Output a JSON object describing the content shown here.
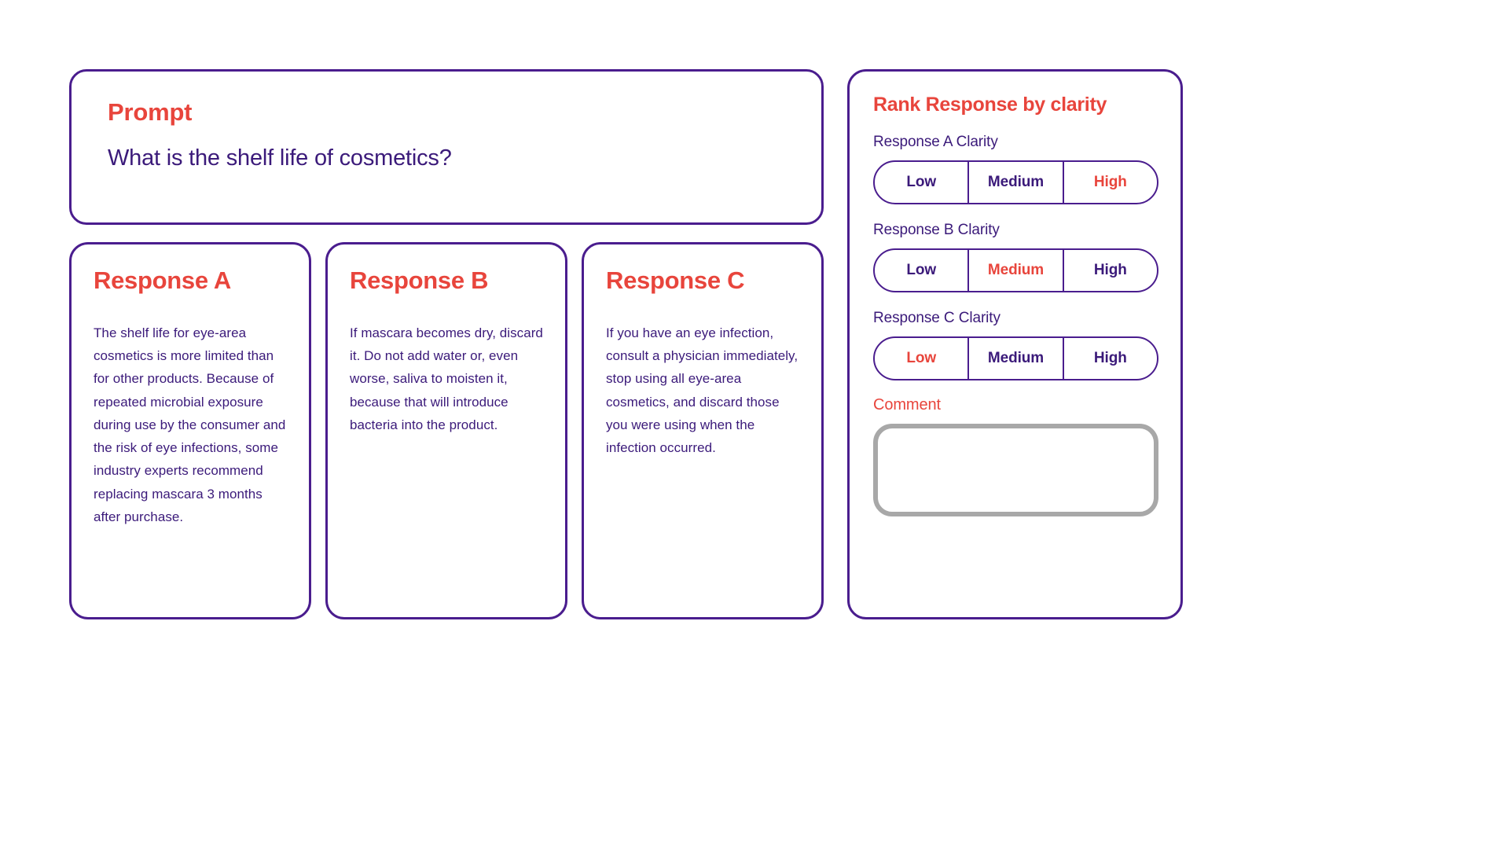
{
  "prompt": {
    "title": "Prompt",
    "question": "What is the shelf life of cosmetics?"
  },
  "responses": [
    {
      "title": "Response A",
      "body": "The shelf life for eye-area cosmetics is more limited than for other products. Because of repeated microbial exposure during use by the consumer and the risk of eye infections, some industry experts recommend replacing mascara 3 months after purchase."
    },
    {
      "title": "Response B",
      "body": "If mascara becomes dry, discard it. Do not add water or, even worse, saliva to moisten it, because that will introduce bacteria into the product."
    },
    {
      "title": "Response C",
      "body": "If you have an eye infection, consult a physician immediately, stop using all eye-area cosmetics, and discard those you were using when the infection occurred."
    }
  ],
  "sidebar": {
    "title": "Rank Response by clarity",
    "rankings": [
      {
        "label": "Response A Clarity",
        "options": [
          "Low",
          "Medium",
          "High"
        ],
        "selected": "High"
      },
      {
        "label": "Response B Clarity",
        "options": [
          "Low",
          "Medium",
          "High"
        ],
        "selected": "Medium"
      },
      {
        "label": "Response C Clarity",
        "options": [
          "Low",
          "Medium",
          "High"
        ],
        "selected": "Low"
      }
    ],
    "comment": {
      "label": "Comment",
      "value": "",
      "placeholder": ""
    }
  },
  "colors": {
    "purple": "#4a1d8e",
    "purple_text": "#3b1a7a",
    "red_accent": "#e8453c",
    "comment_border": "#a8a8a8",
    "background": "#ffffff"
  }
}
